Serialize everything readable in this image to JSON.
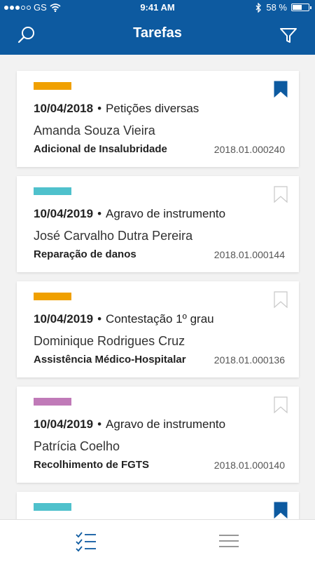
{
  "status_bar": {
    "carrier": "GS",
    "time": "9:41 AM",
    "battery": "58 %",
    "battery_level": 0.58
  },
  "header": {
    "title": "Tarefas",
    "search_icon": "search-icon",
    "filter_icon": "filter-icon"
  },
  "colors": {
    "primary": "#0d5aa0",
    "tag_orange": "#f0a000",
    "tag_teal": "#4fc1cc",
    "tag_purple": "#c07ab8"
  },
  "tasks": [
    {
      "date": "10/04/2018",
      "type": "Petições diversas",
      "name": "Amanda Souza Vieira",
      "subject": "Adicional de Insalubridade",
      "number": "2018.01.000240",
      "tag_color": "#f0a000",
      "bookmarked": true
    },
    {
      "date": "10/04/2019",
      "type": "Agravo de instrumento",
      "name": "José Carvalho Dutra Pereira",
      "subject": "Reparação de danos",
      "number": "2018.01.000144",
      "tag_color": "#4fc1cc",
      "bookmarked": false
    },
    {
      "date": "10/04/2019",
      "type": "Contestação 1º grau",
      "name": "Dominique Rodrigues Cruz",
      "subject": "Assistência Médico-Hospitalar",
      "number": "2018.01.000136",
      "tag_color": "#f0a000",
      "bookmarked": false
    },
    {
      "date": "10/04/2019",
      "type": "Agravo de instrumento",
      "name": "Patrícia Coelho",
      "subject": "Recolhimento de FGTS",
      "number": "2018.01.000140",
      "tag_color": "#c07ab8",
      "bookmarked": false
    },
    {
      "date": "",
      "type": "",
      "name": "",
      "subject": "",
      "number": "",
      "tag_color": "#4fc1cc",
      "bookmarked": true
    }
  ],
  "tab_bar": {
    "tasks_icon": "checklist-icon",
    "menu_icon": "hamburger-menu-icon",
    "active": "tasks"
  }
}
